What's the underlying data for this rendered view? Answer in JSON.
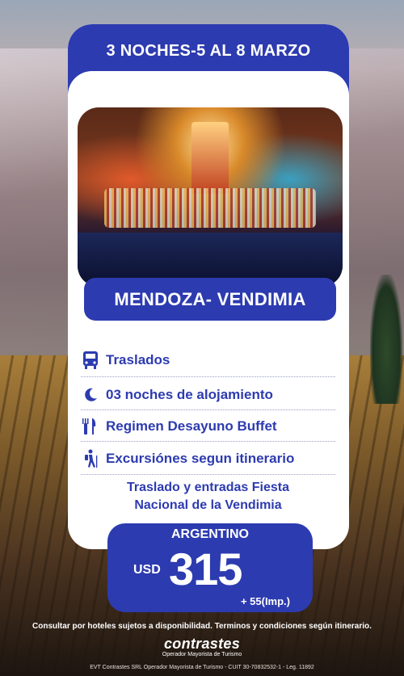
{
  "header": {
    "title": "3 NOCHES-5 AL 8 MARZO"
  },
  "destination": {
    "label": "MENDOZA- VENDIMIA"
  },
  "features": [
    {
      "icon": "bus-icon",
      "text": "Traslados"
    },
    {
      "icon": "moon-icon",
      "text": "03 noches de alojamiento"
    },
    {
      "icon": "fork-knife-icon",
      "text": "Regimen Desayuno Buffet"
    },
    {
      "icon": "hiker-icon",
      "text": "Excursiónes segun itinerario"
    }
  ],
  "extra": {
    "line1": "Traslado y entradas Fiesta",
    "line2": "Nacional de la Vendimia"
  },
  "price": {
    "label": "ARGENTINO",
    "currency": "USD",
    "amount": "315",
    "tax": "+ 55(Imp.)"
  },
  "footer": {
    "disclaimer": "Consultar por hoteles sujetos a disponibilidad. Terminos y condiciones según itinerario.",
    "brand": "contrastes",
    "brand_sub": "Operador Mayorista de Turismo",
    "legal": "EVT Contrastes SRL Operador Mayorista de Turismo - CUIT 30-70832532-1 - Leg. 11892"
  },
  "colors": {
    "primary": "#2d3bb0",
    "card": "#ffffff",
    "text_light": "#ffffff"
  }
}
